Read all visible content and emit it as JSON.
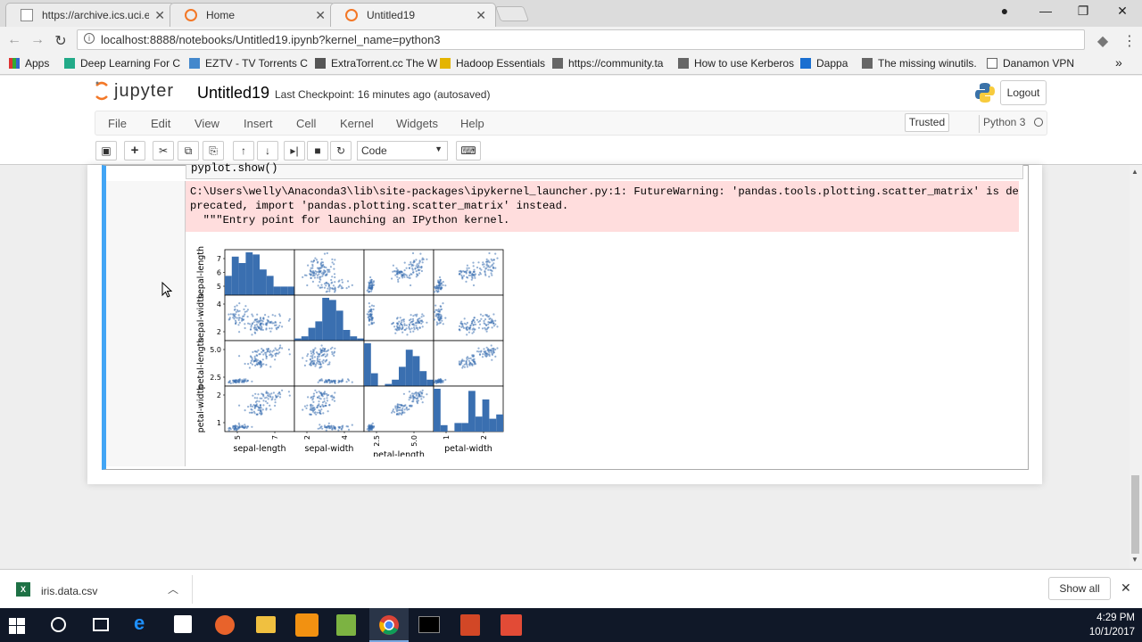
{
  "browser": {
    "tabs": [
      {
        "title": "https://archive.ics.uci.edu",
        "active": false
      },
      {
        "title": "Home",
        "active": false
      },
      {
        "title": "Untitled19",
        "active": true
      }
    ],
    "url": "localhost:8888/notebooks/Untitled19.ipynb?kernel_name=python3",
    "bookmarks": [
      "Apps",
      "Deep Learning For C",
      "EZTV - TV Torrents C",
      "ExtraTorrent.cc The W",
      "Hadoop Essentials",
      "https://community.ta",
      "How to use Kerberos",
      "Dappa",
      "The missing winutils.",
      "Danamon VPN"
    ]
  },
  "jupyter": {
    "logo": "jupyter",
    "notebook_title": "Untitled19",
    "checkpoint": "Last Checkpoint: 16 minutes ago (autosaved)",
    "logout": "Logout",
    "menu": [
      "File",
      "Edit",
      "View",
      "Insert",
      "Cell",
      "Kernel",
      "Widgets",
      "Help"
    ],
    "trusted": "Trusted",
    "kernel": "Python 3",
    "cell_type": "Code"
  },
  "cell": {
    "code_tail": "pyplot.show()",
    "stderr_lines": [
      "C:\\Users\\welly\\Anaconda3\\lib\\site-packages\\ipykernel_launcher.py:1: FutureWarning: 'pandas.tools.plotting.scatter_matrix' is de",
      "precated, import 'pandas.plotting.scatter_matrix' instead.",
      "  \"\"\"Entry point for launching an IPython kernel."
    ]
  },
  "chart_data": {
    "type": "scatter",
    "variables": [
      "sepal-length",
      "sepal-width",
      "petal-length",
      "petal-width"
    ],
    "y_ticks": [
      [
        "5",
        "6",
        "7"
      ],
      [
        "2",
        "4"
      ],
      [
        "2.5",
        "5.0"
      ],
      [
        "1",
        "2"
      ]
    ],
    "x_ticks": [
      [
        "5",
        "7"
      ],
      [
        "2",
        "4"
      ],
      [
        "2.5",
        "5.0"
      ],
      [
        "1",
        "2"
      ]
    ],
    "ranges": [
      [
        4.3,
        7.9
      ],
      [
        2.0,
        4.4
      ],
      [
        1.0,
        6.9
      ],
      [
        0.1,
        2.5
      ]
    ],
    "color": "#3a6fb0",
    "histograms": [
      [
        0.45,
        0.9,
        0.75,
        1.0,
        0.95,
        0.6,
        0.45,
        0.2,
        0.2,
        0.2
      ],
      [
        0.05,
        0.1,
        0.3,
        0.45,
        1.0,
        0.95,
        0.7,
        0.25,
        0.1,
        0.05
      ],
      [
        1.0,
        0.3,
        0.0,
        0.05,
        0.15,
        0.45,
        0.85,
        0.7,
        0.35,
        0.15
      ],
      [
        1.0,
        0.15,
        0.0,
        0.2,
        0.2,
        0.95,
        0.35,
        0.75,
        0.3,
        0.4
      ]
    ]
  },
  "downloads": {
    "file": "iris.data.csv",
    "show_all": "Show all"
  },
  "taskbar": {
    "time": "4:29 PM",
    "date": "10/1/2017"
  }
}
